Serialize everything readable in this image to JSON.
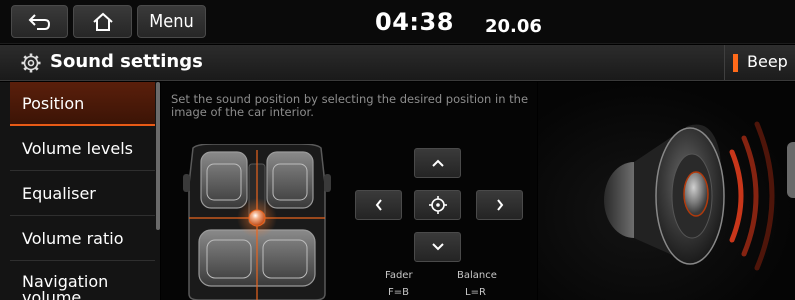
{
  "header": {
    "menu_label": "Menu",
    "time": "04:38",
    "date": "20.06"
  },
  "title_bar": {
    "title": "Sound settings",
    "beep_label": "Beep",
    "accent_color": "#ff6a1a"
  },
  "sidebar": {
    "items": [
      {
        "label": "Position",
        "active": true
      },
      {
        "label": "Volume levels"
      },
      {
        "label": "Equaliser"
      },
      {
        "label": "Volume ratio"
      },
      {
        "label": "Navigation volume"
      }
    ]
  },
  "position_panel": {
    "instructions": "Set the sound position by selecting the desired position in the image of the car interior.",
    "fader_label": "Fader",
    "fader_value": "F=B",
    "balance_label": "Balance",
    "balance_value": "L=R"
  },
  "icons": [
    "back-icon",
    "home-icon",
    "gear-icon",
    "chevron-up-icon",
    "chevron-left-icon",
    "center-target-icon",
    "chevron-right-icon",
    "chevron-down-icon",
    "speaker-icon"
  ]
}
